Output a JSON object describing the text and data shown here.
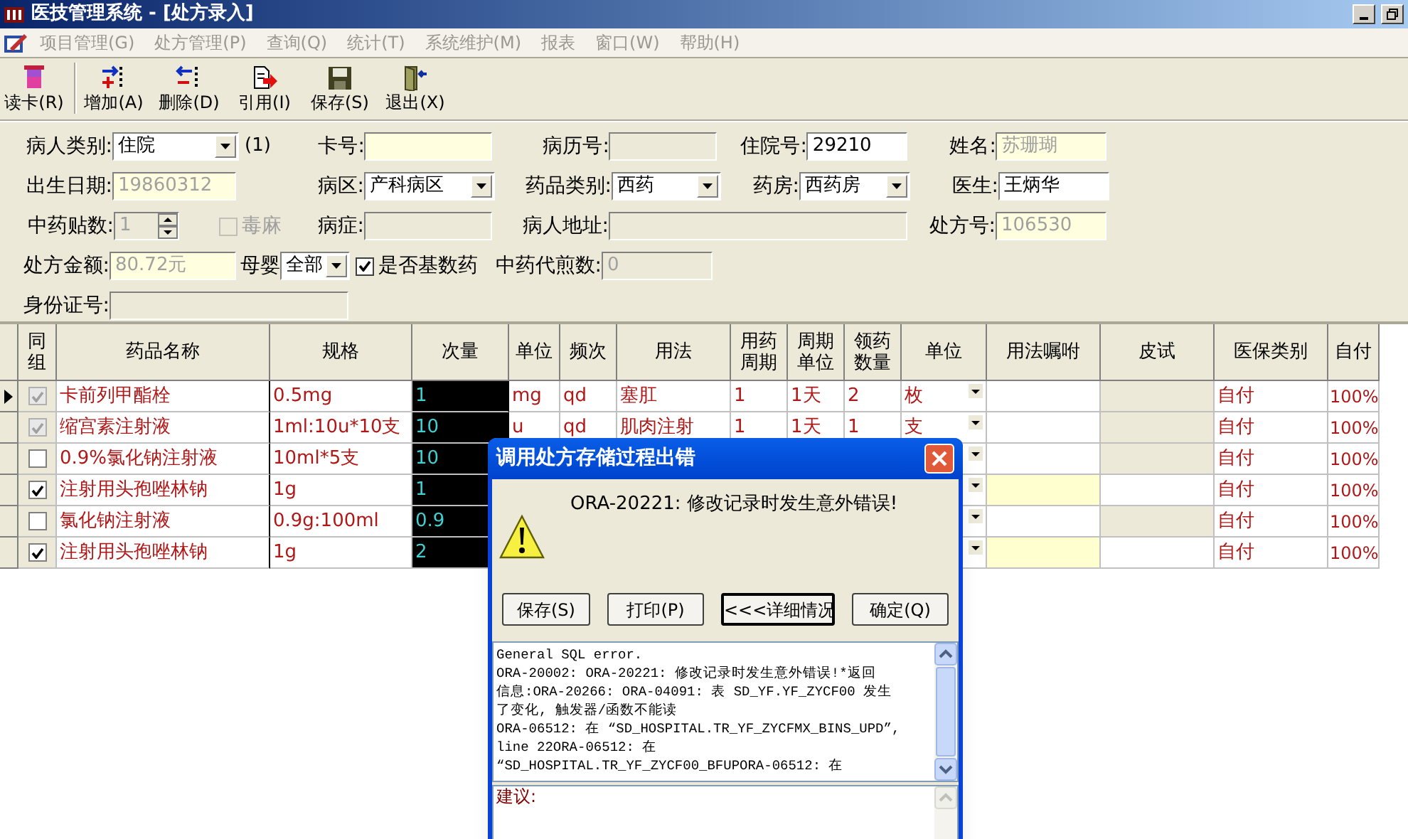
{
  "window": {
    "title": "医技管理系统 - [处方录入]"
  },
  "menu": [
    {
      "label": "项目管理(G)",
      "disabled": true
    },
    {
      "label": "处方管理(P)",
      "disabled": true
    },
    {
      "label": "查询(Q)",
      "disabled": true
    },
    {
      "label": "统计(T)",
      "disabled": true
    },
    {
      "label": "系统维护(M)",
      "disabled": true
    },
    {
      "label": "报表",
      "disabled": true
    },
    {
      "label": "窗口(W)",
      "disabled": true
    },
    {
      "label": "帮助(H)",
      "disabled": true
    }
  ],
  "toolbar": [
    {
      "label": "读卡(R)",
      "kind": "card"
    },
    {
      "label": "增加(A)",
      "kind": "add"
    },
    {
      "label": "删除(D)",
      "kind": "delete"
    },
    {
      "label": "引用(I)",
      "kind": "reference"
    },
    {
      "label": "保存(S)",
      "kind": "save"
    },
    {
      "label": "退出(X)",
      "kind": "exit"
    }
  ],
  "form": {
    "fields": [
      {
        "kind": "select",
        "label": "病人类别:",
        "value": "住院"
      },
      {
        "kind": "note",
        "text": "(1)"
      },
      {
        "kind": "text",
        "label": "卡号:",
        "readonly": true,
        "disabled": false
      },
      {
        "kind": "text",
        "label": "病历号:",
        "disabled": true
      },
      {
        "kind": "text",
        "label": "住院号:",
        "value": "29210",
        "readonly": false,
        "disabled": false
      },
      {
        "kind": "text",
        "label": "姓名:",
        "value": "苏珊瑚",
        "readonly": true,
        "disabled": false
      },
      {
        "kind": "text",
        "label": "出生日期:",
        "value": "19860312",
        "readonly": true,
        "disabled": false
      },
      {
        "kind": "select",
        "label": "病区:",
        "value": "产科病区"
      },
      {
        "kind": "select",
        "label": "药品类别:",
        "value": "西药"
      },
      {
        "kind": "select",
        "label": "药房:",
        "value": "西药房"
      },
      {
        "kind": "text",
        "label": "医生:",
        "value": "王炳华",
        "readonly": false,
        "disabled": false
      },
      {
        "kind": "spin",
        "label": "中药贴数:",
        "value": "1",
        "disabled": true
      },
      {
        "kind": "checkbox",
        "label": "毒麻",
        "checked": false,
        "disabled": true
      },
      {
        "kind": "text",
        "label": "病症:",
        "disabled": true
      },
      {
        "kind": "text",
        "label": "病人地址:",
        "disabled": true
      },
      {
        "kind": "text",
        "label": "处方号:",
        "value": "106530",
        "readonly": true,
        "disabled": false
      },
      {
        "kind": "text",
        "label": "处方金额:",
        "value": "80.72元",
        "readonly": true,
        "disabled": false
      },
      {
        "kind": "select",
        "label": "母婴",
        "value": "全部"
      },
      {
        "kind": "checkbox",
        "label": "是否基数药",
        "checked": true,
        "disabled": false
      },
      {
        "kind": "text",
        "label": "中药代煎数:",
        "value": "0",
        "disabled": true
      },
      {
        "kind": "text",
        "label": "身份证号:",
        "disabled": true
      }
    ]
  },
  "grid": {
    "columns": [
      "同组",
      "药品名称",
      "规格",
      "次量",
      "单位",
      "频次",
      "用法",
      "用药周期",
      "周期单位",
      "领药数量",
      "单位",
      "用法嘱咐",
      "皮试",
      "医保类别",
      "自付"
    ],
    "rows": [
      {
        "selected": true,
        "grouped": true,
        "disabled": true,
        "highlighted": false,
        "drug": "卡前列甲酯栓",
        "spec": "0.5mg",
        "dose": "1",
        "unit": "mg",
        "freq": "qd",
        "usage": "塞肛",
        "period": "1",
        "period_unit": "1天",
        "qty": "2",
        "dispense_unit": "枚",
        "insurance": "自付",
        "self_pay": "100%"
      },
      {
        "selected": false,
        "grouped": true,
        "disabled": true,
        "highlighted": false,
        "drug": "缩宫素注射液",
        "spec": "1ml:10u*10支",
        "dose": "10",
        "unit": "u",
        "freq": "qd",
        "usage": "肌肉注射",
        "period": "1",
        "period_unit": "1天",
        "qty": "1",
        "dispense_unit": "支",
        "insurance": "自付",
        "self_pay": "100%"
      },
      {
        "selected": false,
        "grouped": false,
        "disabled": false,
        "highlighted": false,
        "drug": "0.9%氯化钠注射液",
        "spec": "10ml*5支",
        "dose": "10",
        "insurance": "自付",
        "self_pay": "100%"
      },
      {
        "selected": false,
        "grouped": true,
        "disabled": false,
        "highlighted": true,
        "drug": "注射用头孢唑林钠",
        "spec": "1g",
        "dose": "1",
        "insurance": "自付",
        "self_pay": "100%"
      },
      {
        "selected": false,
        "grouped": false,
        "disabled": false,
        "highlighted": false,
        "drug": "氯化钠注射液",
        "spec": "0.9g:100ml",
        "dose": "0.9",
        "insurance": "自付",
        "self_pay": "100%"
      },
      {
        "selected": false,
        "grouped": true,
        "disabled": false,
        "highlighted": true,
        "drug": "注射用头孢唑林钠",
        "spec": "1g",
        "dose": "2",
        "insurance": "自付",
        "self_pay": "100%"
      }
    ]
  },
  "dialog": {
    "title": "调用处方存储过程出错",
    "message": "ORA-20221: 修改记录时发生意外错误!",
    "buttons": [
      {
        "label": "保存(S)",
        "focused": false
      },
      {
        "label": "打印(P)",
        "focused": false
      },
      {
        "label": "<<<详细情况",
        "focused": true
      },
      {
        "label": "确定(Q)",
        "focused": false
      }
    ],
    "detail_lines": [
      "General SQL error.",
      "ORA-20002: ORA-20221: 修改记录时发生意外错误!*返回",
      "信息:ORA-20266: ORA-04091: 表 SD_YF.YF_ZYCF00 发生",
      "了变化, 触发器/函数不能读",
      "ORA-06512: 在 “SD_HOSPITAL.TR_YF_ZYCFMX_BINS_UPD”,",
      "line 22ORA-06512: 在",
      "“SD_HOSPITAL.TR_YF_ZYCF00_BFUPORA-06512: 在"
    ],
    "suggestion_label": "建议:"
  }
}
